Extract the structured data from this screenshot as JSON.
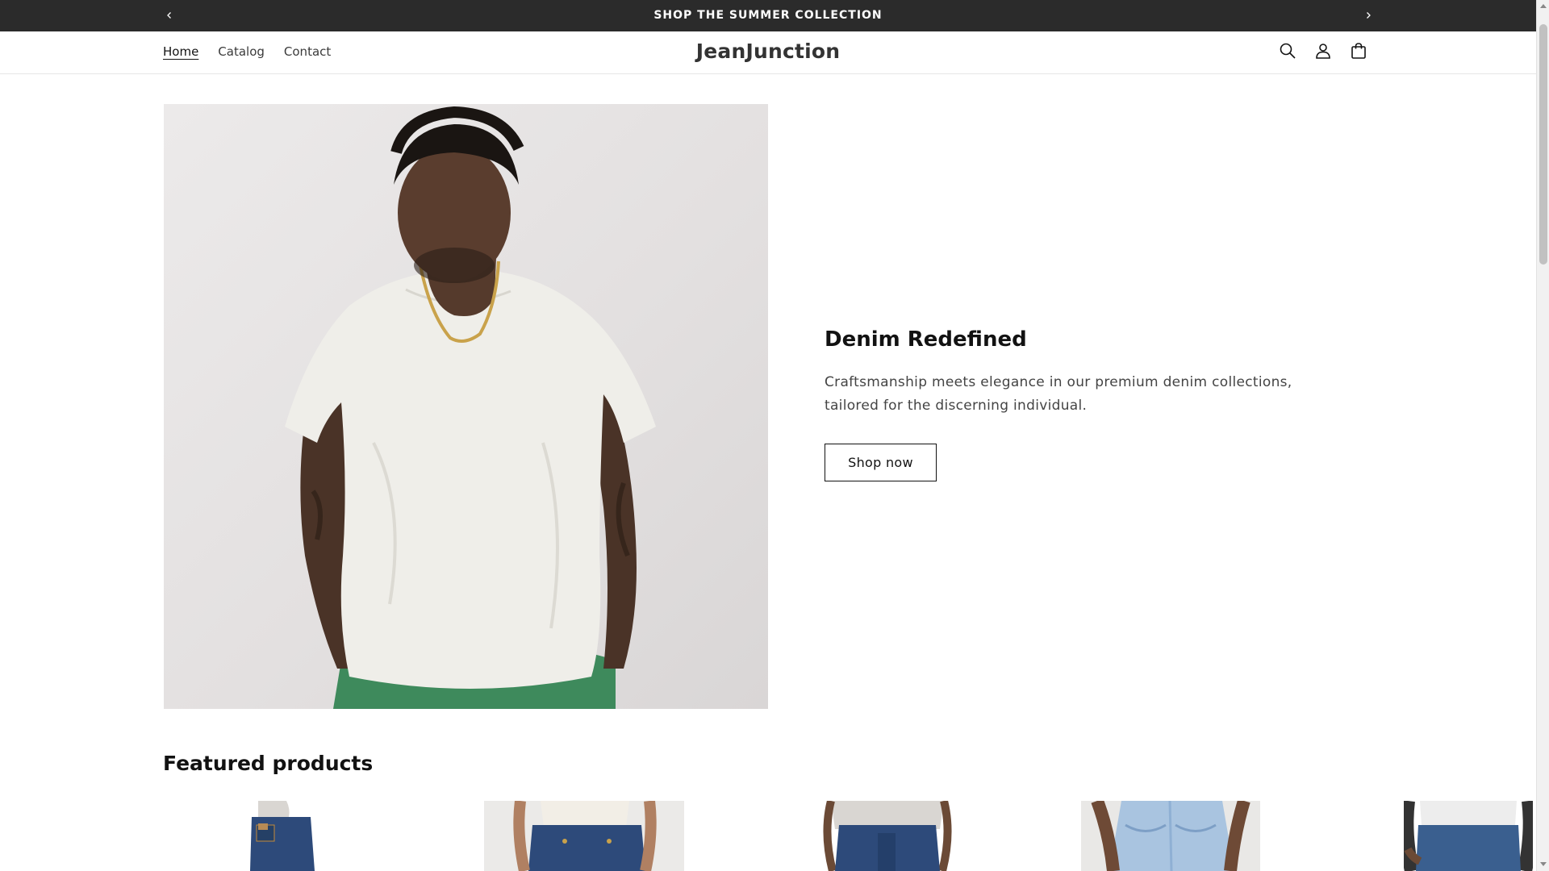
{
  "announcement": {
    "text": "SHOP THE SUMMER COLLECTION",
    "prev_icon": "chevron-left-icon",
    "next_icon": "chevron-right-icon"
  },
  "header": {
    "logo": "JeanJunction",
    "nav": [
      {
        "label": "Home",
        "active": true
      },
      {
        "label": "Catalog",
        "active": false
      },
      {
        "label": "Contact",
        "active": false
      }
    ],
    "icons": [
      "search-icon",
      "account-icon",
      "cart-icon"
    ]
  },
  "hero": {
    "title": "Denim Redefined",
    "text": "Craftsmanship meets elegance in our premium denim collections, tailored for the discerning individual.",
    "button_label": "Shop now"
  },
  "featured": {
    "title": "Featured products"
  },
  "colors": {
    "announcement_bg": "#2b2b2b",
    "text": "#121212",
    "denim_dark": "#2d4a7a",
    "denim_light": "#a9c4e0"
  }
}
